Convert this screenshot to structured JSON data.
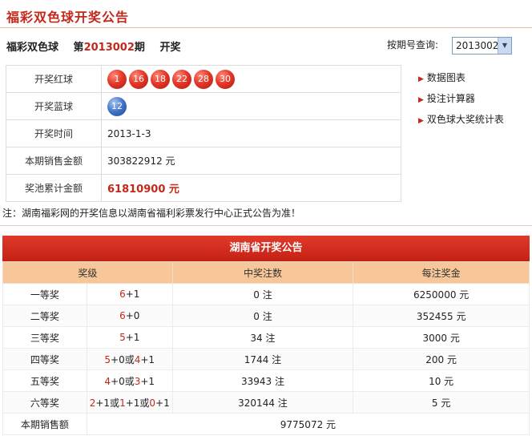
{
  "page_title": "福彩双色球开奖公告",
  "draw_header": {
    "game": "福彩双色球",
    "prefix": "第",
    "issue": "2013002",
    "suffix": "期",
    "tag": "开奖"
  },
  "query": {
    "label": "按期号查询:",
    "selected": "2013002"
  },
  "info": {
    "red_label": "开奖红球",
    "red_balls": [
      "1",
      "16",
      "18",
      "22",
      "28",
      "30"
    ],
    "blue_label": "开奖蓝球",
    "blue_ball": "12",
    "time_label": "开奖时间",
    "time_value": "2013-1-3",
    "sales_label": "本期销售金额",
    "sales_value": "303822912 元",
    "pool_label": "奖池累计金额",
    "pool_value": "61810900 元"
  },
  "links": [
    "数据图表",
    "投注计算器",
    "双色球大奖统计表"
  ],
  "note": "注：湖南福彩网的开奖信息以湖南省福利彩票发行中心正式公告为准！",
  "province": {
    "title": "湖南省开奖公告",
    "headers": [
      "奖级",
      "中奖注数",
      "每注奖金"
    ],
    "rows": [
      {
        "level": "一等奖",
        "cond": [
          [
            "6",
            "r"
          ],
          [
            "+1",
            ""
          ]
        ],
        "count": "0 注",
        "prize": "6250000 元"
      },
      {
        "level": "二等奖",
        "cond": [
          [
            "6",
            "r"
          ],
          [
            "+0",
            ""
          ]
        ],
        "count": "0 注",
        "prize": "352455 元"
      },
      {
        "level": "三等奖",
        "cond": [
          [
            "5",
            "r"
          ],
          [
            "+1",
            ""
          ]
        ],
        "count": "34 注",
        "prize": "3000 元"
      },
      {
        "level": "四等奖",
        "cond": [
          [
            "5",
            "r"
          ],
          [
            "+0或",
            ""
          ],
          [
            "4",
            "r"
          ],
          [
            "+1",
            ""
          ]
        ],
        "count": "1744 注",
        "prize": "200 元"
      },
      {
        "level": "五等奖",
        "cond": [
          [
            "4",
            "r"
          ],
          [
            "+0或",
            ""
          ],
          [
            "3",
            "r"
          ],
          [
            "+1",
            ""
          ]
        ],
        "count": "33943 注",
        "prize": "10 元"
      },
      {
        "level": "六等奖",
        "cond": [
          [
            "2",
            "r"
          ],
          [
            "+1或",
            ""
          ],
          [
            "1",
            "r"
          ],
          [
            "+1或",
            ""
          ],
          [
            "0",
            "r"
          ],
          [
            "+1",
            ""
          ]
        ],
        "count": "320144 注",
        "prize": "5 元"
      }
    ],
    "sales_label": "本期销售额",
    "sales_value": "9775072 元"
  }
}
